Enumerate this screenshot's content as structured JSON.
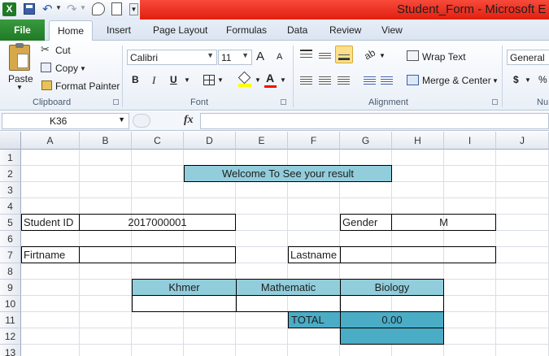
{
  "app": {
    "window_title": "Student_Form  -  Microsoft E",
    "icon_text": "X"
  },
  "tabs": [
    {
      "label": "File"
    },
    {
      "label": "Home"
    },
    {
      "label": "Insert"
    },
    {
      "label": "Page Layout"
    },
    {
      "label": "Formulas"
    },
    {
      "label": "Data"
    },
    {
      "label": "Review"
    },
    {
      "label": "View"
    }
  ],
  "ribbon": {
    "clipboard": {
      "paste": "Paste",
      "cut": "Cut",
      "copy": "Copy",
      "format_painter": "Format Painter",
      "group": "Clipboard"
    },
    "font": {
      "name": "Calibri",
      "size": "11",
      "grow": "A",
      "shrink": "A",
      "bold": "B",
      "italic": "I",
      "underline": "U",
      "font_color_letter": "A",
      "group": "Font"
    },
    "alignment": {
      "wrap_text": "Wrap Text",
      "merge_center": "Merge & Center",
      "group": "Alignment"
    },
    "number": {
      "format": "General",
      "currency": "$",
      "percent": "%",
      "group": "Nu"
    }
  },
  "formula_bar": {
    "name_box": "K36",
    "fx": "fx",
    "value": ""
  },
  "columns": [
    "A",
    "B",
    "C",
    "D",
    "E",
    "F",
    "G",
    "H",
    "I",
    "J"
  ],
  "rows": [
    "1",
    "2",
    "3",
    "4",
    "5",
    "6",
    "7",
    "8",
    "9",
    "10",
    "11",
    "12",
    "13"
  ],
  "form": {
    "header": "Welcome To See your result",
    "student_id_label": "Student ID",
    "student_id": "2017000001",
    "gender_label": "Gender",
    "gender": "M",
    "firstname_label": "Firtname",
    "firstname": "",
    "lastname_label": "Lastname",
    "lastname": "",
    "subjects": [
      "Khmer",
      "Mathematic",
      "Biology"
    ],
    "scores": [
      "",
      "",
      ""
    ],
    "total_label": "TOTAL",
    "total": "0.00"
  },
  "colors": {
    "title_red": "#e11f10",
    "file_green": "#1e7a25",
    "header_blue": "#92cddc",
    "total_teal": "#4bacc6"
  }
}
